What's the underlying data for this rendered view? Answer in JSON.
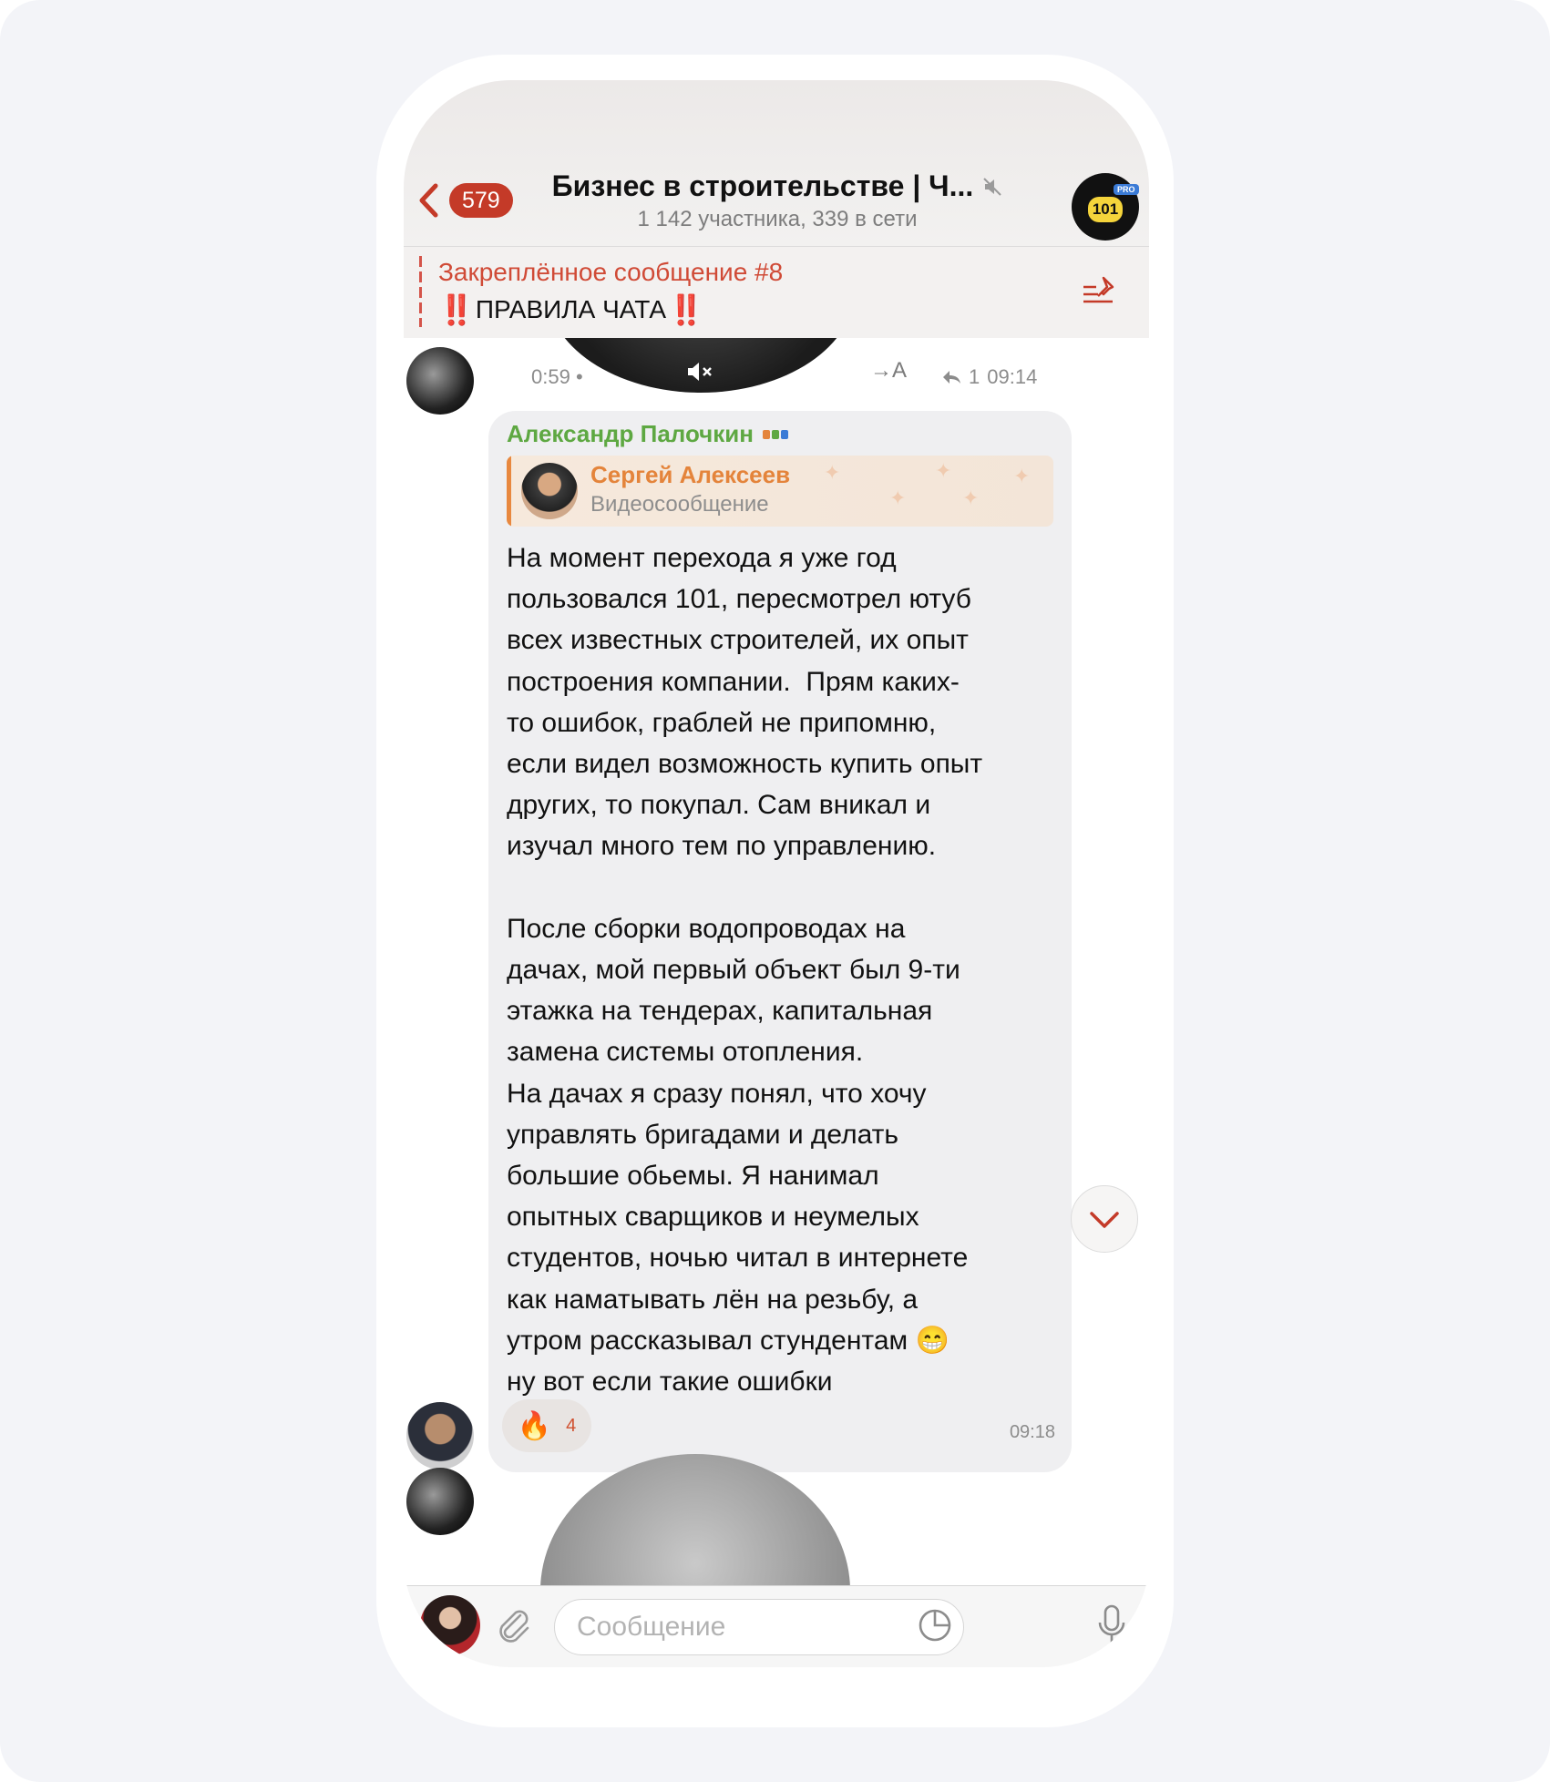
{
  "header": {
    "back_badge": "579",
    "title": "Бизнес в строительстве | Ч...",
    "subtitle": "1 142 участника, 339 в сети",
    "channel_logo_text": "101",
    "channel_logo_badge": "PRO"
  },
  "pinned": {
    "title": "Закреплённое сообщение #8",
    "text": "ПРАВИЛА ЧАТА",
    "emoji": "‼️"
  },
  "video_message_top": {
    "duration": "0:59",
    "replies": "1",
    "time": "09:14",
    "translate_label": "→A"
  },
  "message": {
    "sender": "Александр Палочкин",
    "reply": {
      "name": "Сергей Алексеев",
      "text": "Видеосообщение"
    },
    "text": "На момент перехода я уже год\nпользовался 101, пересмотрел ютуб\nвсех известных строителей, их опыт\nпостроения компании.  Прям каких-\nто ошибок, граблей не припомню,\nесли видел возможность купить опыт\nдругих, то покупал. Сам вникал и\nизучал много тем по управлению.\n\nПосле сборки водопроводах на\nдачах, мой первый объект был 9-ти\nэтажка на тендерах, капитальная\nзамена системы отопления.\nНа дачах я сразу понял, что хочу\nуправлять бригадами и делать\nбольшие обьемы. Я нанимал\nопытных сварщиков и неумелых\nстудентов, ночью читал в интернете\nкак наматывать лён на резьбу, а\nутром рассказывал стундентам 😁\nну вот если такие ошибки",
    "reaction_emoji": "🔥",
    "reaction_count": "4",
    "time": "09:18"
  },
  "input": {
    "placeholder": "Сообщение"
  },
  "colors": {
    "accent": "#c43a28",
    "sender_name": "#5ea842",
    "reply_name": "#e4843b",
    "bubble": "#efeff1"
  },
  "icons": [
    "back-chevron-icon",
    "muted-icon",
    "pin-list-icon",
    "speaker-muted-icon",
    "translate-icon",
    "reply-arrow-icon",
    "chevron-down-icon",
    "paperclip-icon",
    "sticker-icon",
    "microphone-icon"
  ]
}
